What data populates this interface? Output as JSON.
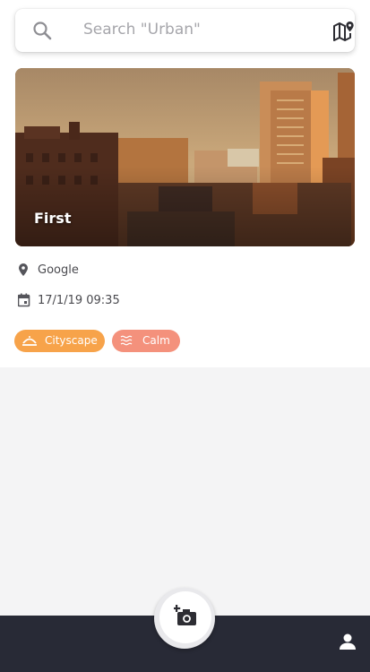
{
  "search": {
    "placeholder": "Search \"Urban\"",
    "icon": "search-icon",
    "map_icon": "map-pin-icon"
  },
  "card": {
    "title": "First"
  },
  "meta": {
    "location": {
      "icon": "location-pin-icon",
      "text": "Google"
    },
    "date": {
      "icon": "calendar-icon",
      "text": "17/1/19 09:35"
    }
  },
  "tags": [
    {
      "label": "Cityscape",
      "icon": "horizon-icon",
      "color": "#f7a34a"
    },
    {
      "label": "Calm",
      "icon": "waves-icon",
      "color": "#f4917c"
    }
  ],
  "bottom_nav": {
    "camera_icon": "add-photo-icon",
    "profile_icon": "person-icon",
    "bar_color": "#282a36"
  }
}
